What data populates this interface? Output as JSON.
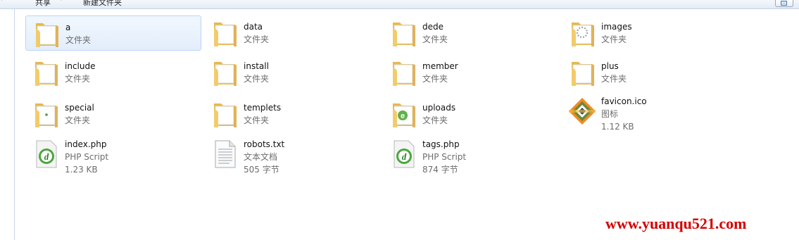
{
  "toolbar": {
    "items": [
      "共享",
      "新建文件夹"
    ]
  },
  "files": [
    {
      "name": "a",
      "type": "文件夹",
      "size": "",
      "icon": "folder-icon",
      "selected": true
    },
    {
      "name": "data",
      "type": "文件夹",
      "size": "",
      "icon": "folder-icon"
    },
    {
      "name": "dede",
      "type": "文件夹",
      "size": "",
      "icon": "folder-icon"
    },
    {
      "name": "images",
      "type": "文件夹",
      "size": "",
      "icon": "folder-images-icon"
    },
    {
      "name": "include",
      "type": "文件夹",
      "size": "",
      "icon": "folder-icon"
    },
    {
      "name": "install",
      "type": "文件夹",
      "size": "",
      "icon": "folder-icon"
    },
    {
      "name": "member",
      "type": "文件夹",
      "size": "",
      "icon": "folder-icon"
    },
    {
      "name": "plus",
      "type": "文件夹",
      "size": "",
      "icon": "folder-icon"
    },
    {
      "name": "special",
      "type": "文件夹",
      "size": "",
      "icon": "folder-icon"
    },
    {
      "name": "templets",
      "type": "文件夹",
      "size": "",
      "icon": "folder-icon"
    },
    {
      "name": "uploads",
      "type": "文件夹",
      "size": "",
      "icon": "folder-ie-icon"
    },
    {
      "name": "favicon.ico",
      "type": "图标",
      "size": "1.12 KB",
      "icon": "favicon-icon"
    },
    {
      "name": "index.php",
      "type": "PHP Script",
      "size": "1.23 KB",
      "icon": "php-script-icon"
    },
    {
      "name": "robots.txt",
      "type": "文本文档",
      "size": "505 字节",
      "icon": "text-document-icon"
    },
    {
      "name": "tags.php",
      "type": "PHP Script",
      "size": "874 字节",
      "icon": "php-script-icon"
    }
  ],
  "watermark": "www.yuanqu521.com",
  "colors": {
    "selection": "#e3eefb",
    "selection_border": "#b9d5f4",
    "folder": "#f2cc6b",
    "watermark": "#d40000"
  }
}
